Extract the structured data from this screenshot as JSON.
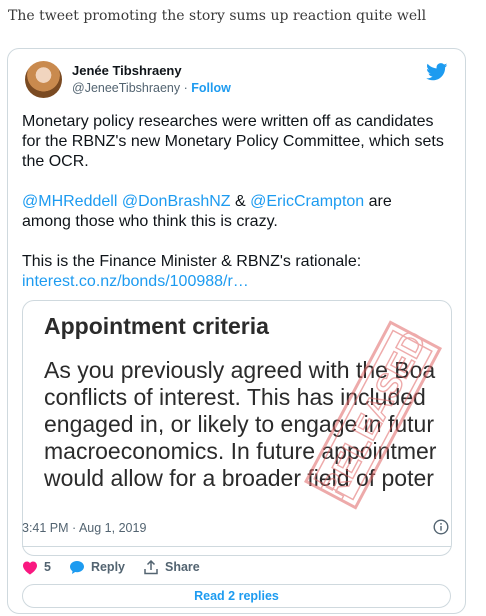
{
  "intro": {
    "text": "The tweet promoting the story sums up reaction quite well"
  },
  "tweet": {
    "author_name": "Jenée Tibshraeny",
    "handle": "@JeneeTibshraeny",
    "separator": "·",
    "follow_label": "Follow",
    "line1": "Monetary policy researches were written off as candidates for the RBNZ's new Monetary Policy Committee, which sets the OCR.",
    "mention1": "@MHReddell",
    "mention2": "@DonBrashNZ",
    "amp": "&",
    "mention3": "@EricCrampton",
    "line2_tail": "are",
    "line2b": "among those who think this is crazy.",
    "line3": "This is the Finance Minister & RBNZ's rationale:",
    "link": "interest.co.nz/bonds/100988/r…",
    "timestamp": "3:41 PM · Aug 1, 2019",
    "likes_count": "5",
    "reply_label": "Reply",
    "share_label": "Share",
    "read_replies_label": "Read 2 replies"
  },
  "media": {
    "heading": "Appointment criteria",
    "lines": [
      "As you previously agreed with the Boa",
      "conflicts of interest. This has included",
      "engaged in, or likely to engage in futur",
      "macroeconomics. In future appointmer",
      "would allow for a broader field of poter"
    ],
    "stamp_text": "RELEASED"
  },
  "colors": {
    "accent": "#1d9bf0",
    "like": "#f91880",
    "text": "#0f1419",
    "muted": "#536471",
    "stamp": "#e06666"
  },
  "icons": {
    "brand": "twitter-bird-icon",
    "info": "info-icon",
    "like": "heart-icon",
    "reply": "speech-bubble-icon",
    "share": "share-upload-icon"
  }
}
